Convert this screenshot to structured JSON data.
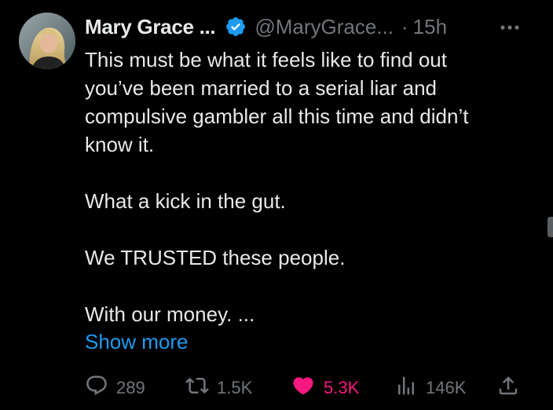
{
  "tweet": {
    "author_name": "Mary Grace ...",
    "handle": "@MaryGrace...",
    "separator": "·",
    "time": "15h",
    "body_lines": [
      "This must be what it feels like to find out",
      "you’ve been married to a serial liar and",
      "compulsive gambler all this time and didn’t",
      "know it.",
      "",
      "What a kick in the gut.",
      "",
      "We TRUSTED these people.",
      "",
      "With our money. ..."
    ],
    "show_more_label": "Show more",
    "actions": {
      "replies": "289",
      "reposts": "1.5K",
      "likes": "5.3K",
      "views": "146K"
    }
  },
  "colors": {
    "background": "#000000",
    "text": "#e7e9ea",
    "muted": "#71767b",
    "link": "#1d9bf0",
    "like": "#f91880",
    "verified": "#1d9bf0"
  },
  "icons": {
    "more": "more-dots-icon",
    "verified": "verified-badge-icon",
    "reply": "reply-icon",
    "repost": "repost-icon",
    "like": "heart-icon",
    "views": "views-chart-icon",
    "share": "share-icon"
  }
}
